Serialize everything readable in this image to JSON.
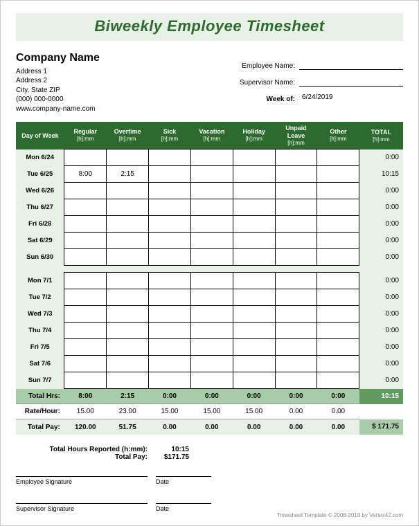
{
  "title": "Biweekly Employee Timesheet",
  "company": {
    "name": "Company Name",
    "address1": "Address 1",
    "address2": "Address 2",
    "citystate": "City, State  ZIP",
    "phone": "(000) 000-0000",
    "website": "www.company-name.com"
  },
  "fields": {
    "employee_label": "Employee Name:",
    "employee_value": "",
    "supervisor_label": "Supervisor Name:",
    "supervisor_value": "",
    "weekof_label": "Week of:",
    "weekof_value": "6/24/2019"
  },
  "columns": {
    "day": "Day of Week",
    "regular": "Regular",
    "overtime": "Overtime",
    "sick": "Sick",
    "vacation": "Vacation",
    "holiday": "Holiday",
    "unpaid": "Unpaid Leave",
    "other": "Other",
    "total": "TOTAL",
    "sub": "[h]:mm"
  },
  "week1": [
    {
      "day": "Mon 6/24",
      "regular": "",
      "overtime": "",
      "sick": "",
      "vacation": "",
      "holiday": "",
      "unpaid": "",
      "other": "",
      "total": "0:00"
    },
    {
      "day": "Tue 6/25",
      "regular": "8:00",
      "overtime": "2:15",
      "sick": "",
      "vacation": "",
      "holiday": "",
      "unpaid": "",
      "other": "",
      "total": "10:15"
    },
    {
      "day": "Wed 6/26",
      "regular": "",
      "overtime": "",
      "sick": "",
      "vacation": "",
      "holiday": "",
      "unpaid": "",
      "other": "",
      "total": "0:00"
    },
    {
      "day": "Thu 6/27",
      "regular": "",
      "overtime": "",
      "sick": "",
      "vacation": "",
      "holiday": "",
      "unpaid": "",
      "other": "",
      "total": "0:00"
    },
    {
      "day": "Fri 6/28",
      "regular": "",
      "overtime": "",
      "sick": "",
      "vacation": "",
      "holiday": "",
      "unpaid": "",
      "other": "",
      "total": "0:00"
    },
    {
      "day": "Sat 6/29",
      "regular": "",
      "overtime": "",
      "sick": "",
      "vacation": "",
      "holiday": "",
      "unpaid": "",
      "other": "",
      "total": "0:00"
    },
    {
      "day": "Sun 6/30",
      "regular": "",
      "overtime": "",
      "sick": "",
      "vacation": "",
      "holiday": "",
      "unpaid": "",
      "other": "",
      "total": "0:00"
    }
  ],
  "week2": [
    {
      "day": "Mon 7/1",
      "regular": "",
      "overtime": "",
      "sick": "",
      "vacation": "",
      "holiday": "",
      "unpaid": "",
      "other": "",
      "total": "0:00"
    },
    {
      "day": "Tue 7/2",
      "regular": "",
      "overtime": "",
      "sick": "",
      "vacation": "",
      "holiday": "",
      "unpaid": "",
      "other": "",
      "total": "0:00"
    },
    {
      "day": "Wed 7/3",
      "regular": "",
      "overtime": "",
      "sick": "",
      "vacation": "",
      "holiday": "",
      "unpaid": "",
      "other": "",
      "total": "0:00"
    },
    {
      "day": "Thu 7/4",
      "regular": "",
      "overtime": "",
      "sick": "",
      "vacation": "",
      "holiday": "",
      "unpaid": "",
      "other": "",
      "total": "0:00"
    },
    {
      "day": "Fri 7/5",
      "regular": "",
      "overtime": "",
      "sick": "",
      "vacation": "",
      "holiday": "",
      "unpaid": "",
      "other": "",
      "total": "0:00"
    },
    {
      "day": "Sat 7/6",
      "regular": "",
      "overtime": "",
      "sick": "",
      "vacation": "",
      "holiday": "",
      "unpaid": "",
      "other": "",
      "total": "0:00"
    },
    {
      "day": "Sun 7/7",
      "regular": "",
      "overtime": "",
      "sick": "",
      "vacation": "",
      "holiday": "",
      "unpaid": "",
      "other": "",
      "total": "0:00"
    }
  ],
  "totals": {
    "label": "Total Hrs:",
    "regular": "8:00",
    "overtime": "2:15",
    "sick": "0:00",
    "vacation": "0:00",
    "holiday": "0:00",
    "unpaid": "0:00",
    "other": "0:00",
    "grand": "10:15"
  },
  "rate": {
    "label": "Rate/Hour:",
    "regular": "15.00",
    "overtime": "23.00",
    "sick": "15.00",
    "vacation": "15.00",
    "holiday": "15.00",
    "unpaid": "0.00",
    "other": "0.00"
  },
  "pay": {
    "label": "Total Pay:",
    "regular": "120.00",
    "overtime": "51.75",
    "sick": "0.00",
    "vacation": "0.00",
    "holiday": "0.00",
    "unpaid": "0.00",
    "other": "0.00",
    "grand": "$   171.75"
  },
  "summary": {
    "hours_label": "Total Hours Reported (h:mm):",
    "hours_value": "10:15",
    "pay_label": "Total Pay:",
    "pay_value": "$171.75"
  },
  "signatures": {
    "employee": "Employee Signature",
    "supervisor": "Supervisor Signature",
    "date": "Date"
  },
  "footer": "Timesheet Template © 2008-2019 by Vertex42.com"
}
